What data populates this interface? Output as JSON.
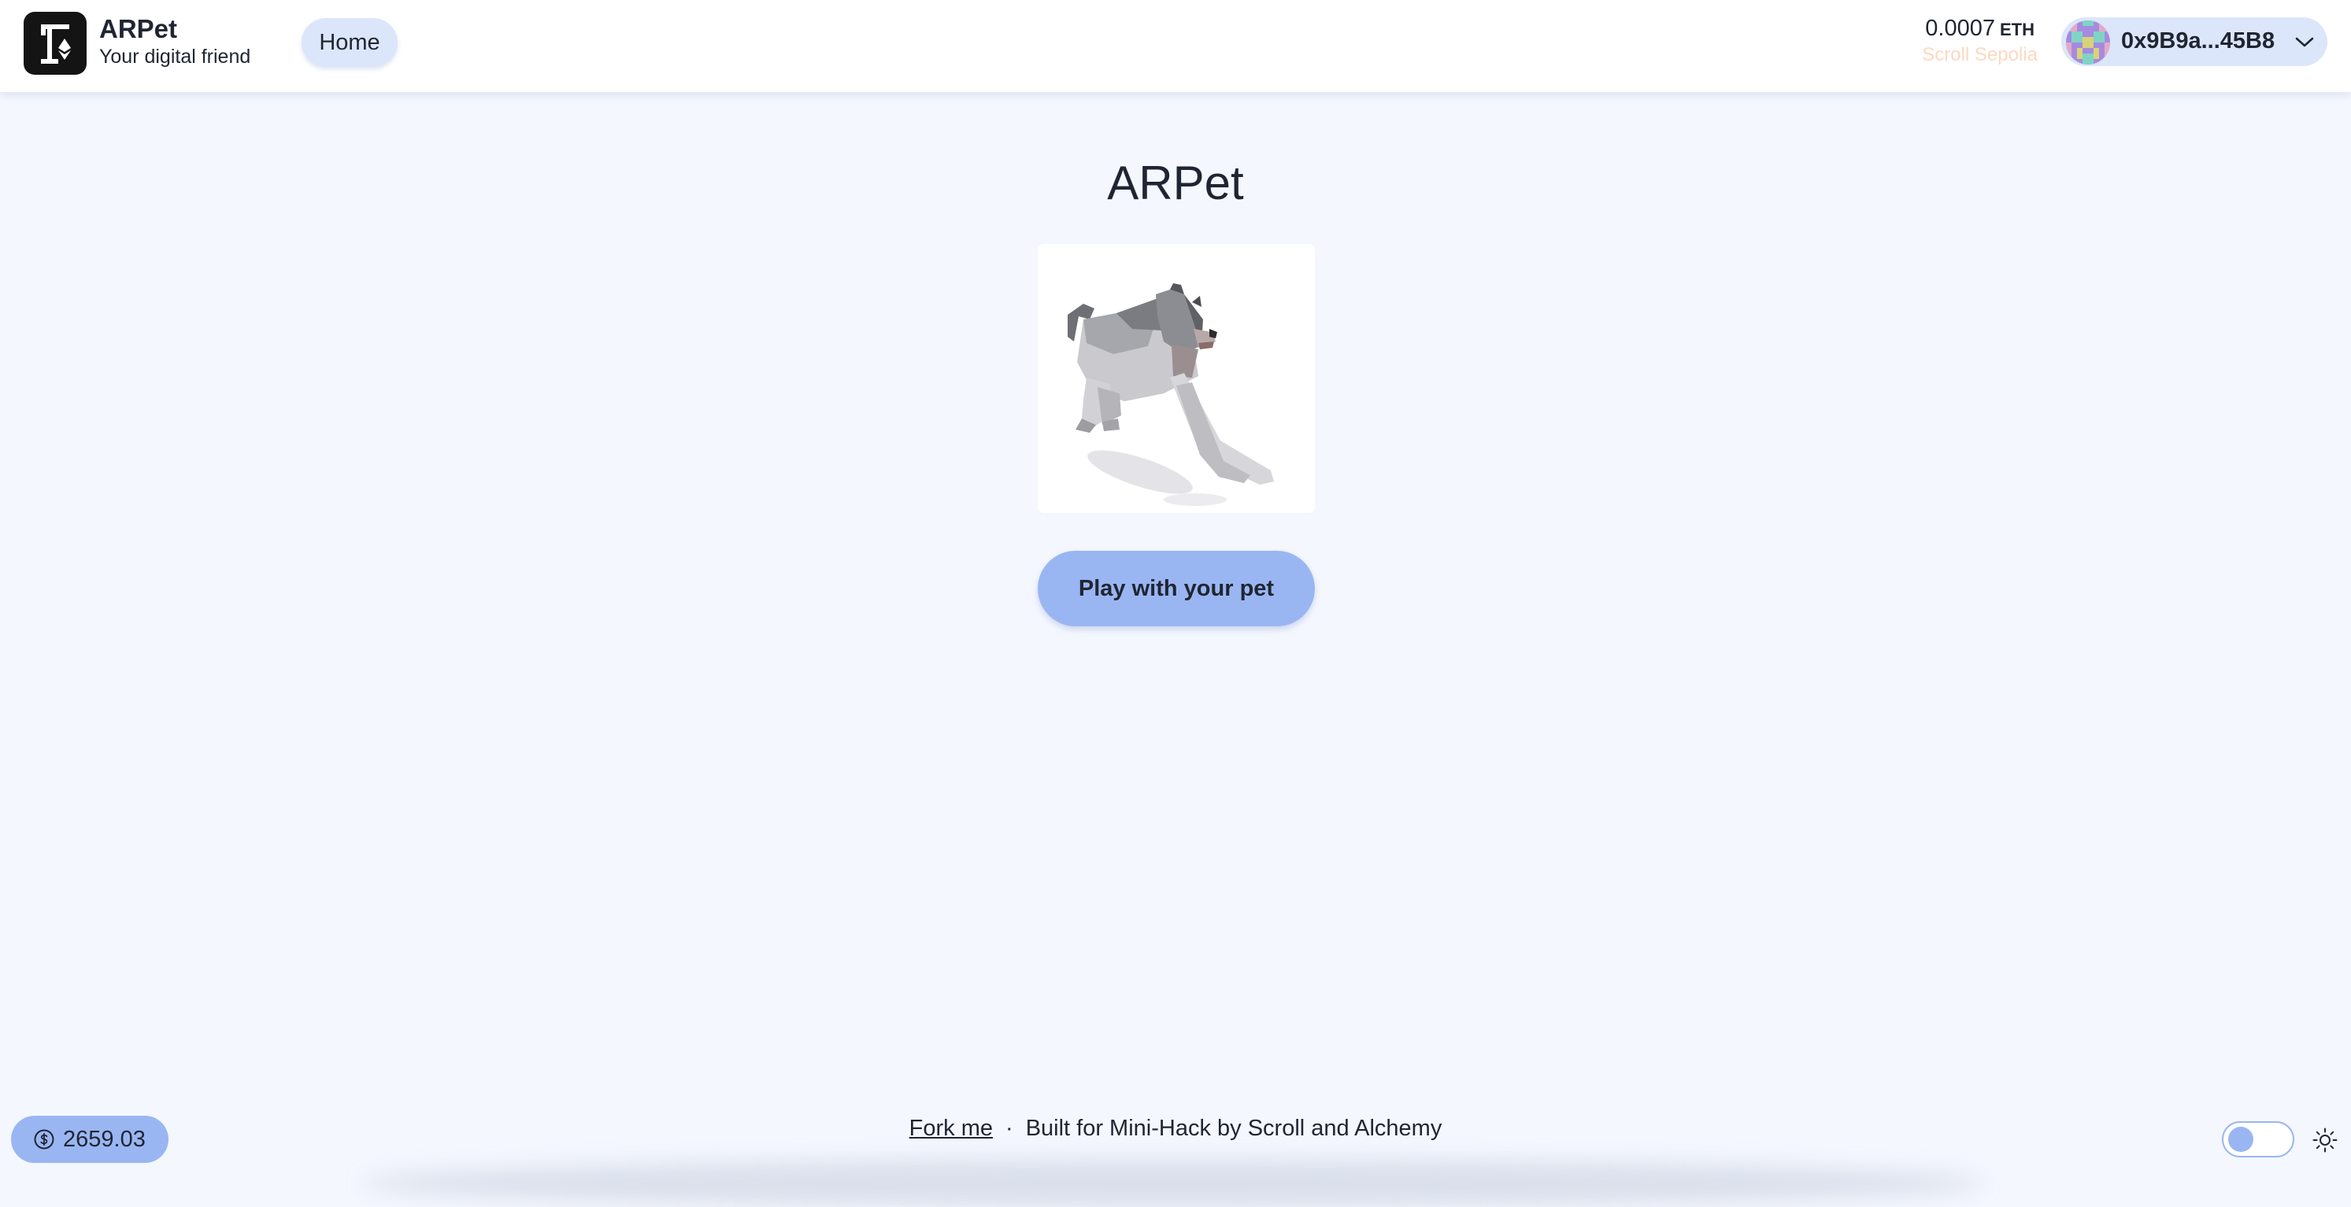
{
  "header": {
    "app_name": "ARPet",
    "tagline": "Your digital friend",
    "logo_icon": "scaffold-eth-logo-icon",
    "nav": {
      "home_label": "Home"
    },
    "balance": {
      "amount": "0.0007",
      "unit": "ETH"
    },
    "network": "Scroll Sepolia",
    "account": {
      "address": "0x9B9a...45B8",
      "avatar_icon": "blockie-avatar-icon",
      "dropdown_icon": "chevron-down-icon"
    }
  },
  "main": {
    "title": "ARPet",
    "pet_image_icon": "low-poly-dog-image",
    "play_button_label": "Play with your pet"
  },
  "footer": {
    "price_value": "2659.03",
    "price_icon": "currency-dollar-icon",
    "fork_link_label": "Fork me",
    "separator": "·",
    "built_text": "Built for Mini-Hack by Scroll and Alchemy",
    "theme_icon": "sun-icon"
  },
  "colors": {
    "background": "#f4f7fe",
    "accent": "#9ab6f2",
    "accent_light": "#dce6fb",
    "text": "#1f2532",
    "network_text": "#fbd9c2"
  }
}
